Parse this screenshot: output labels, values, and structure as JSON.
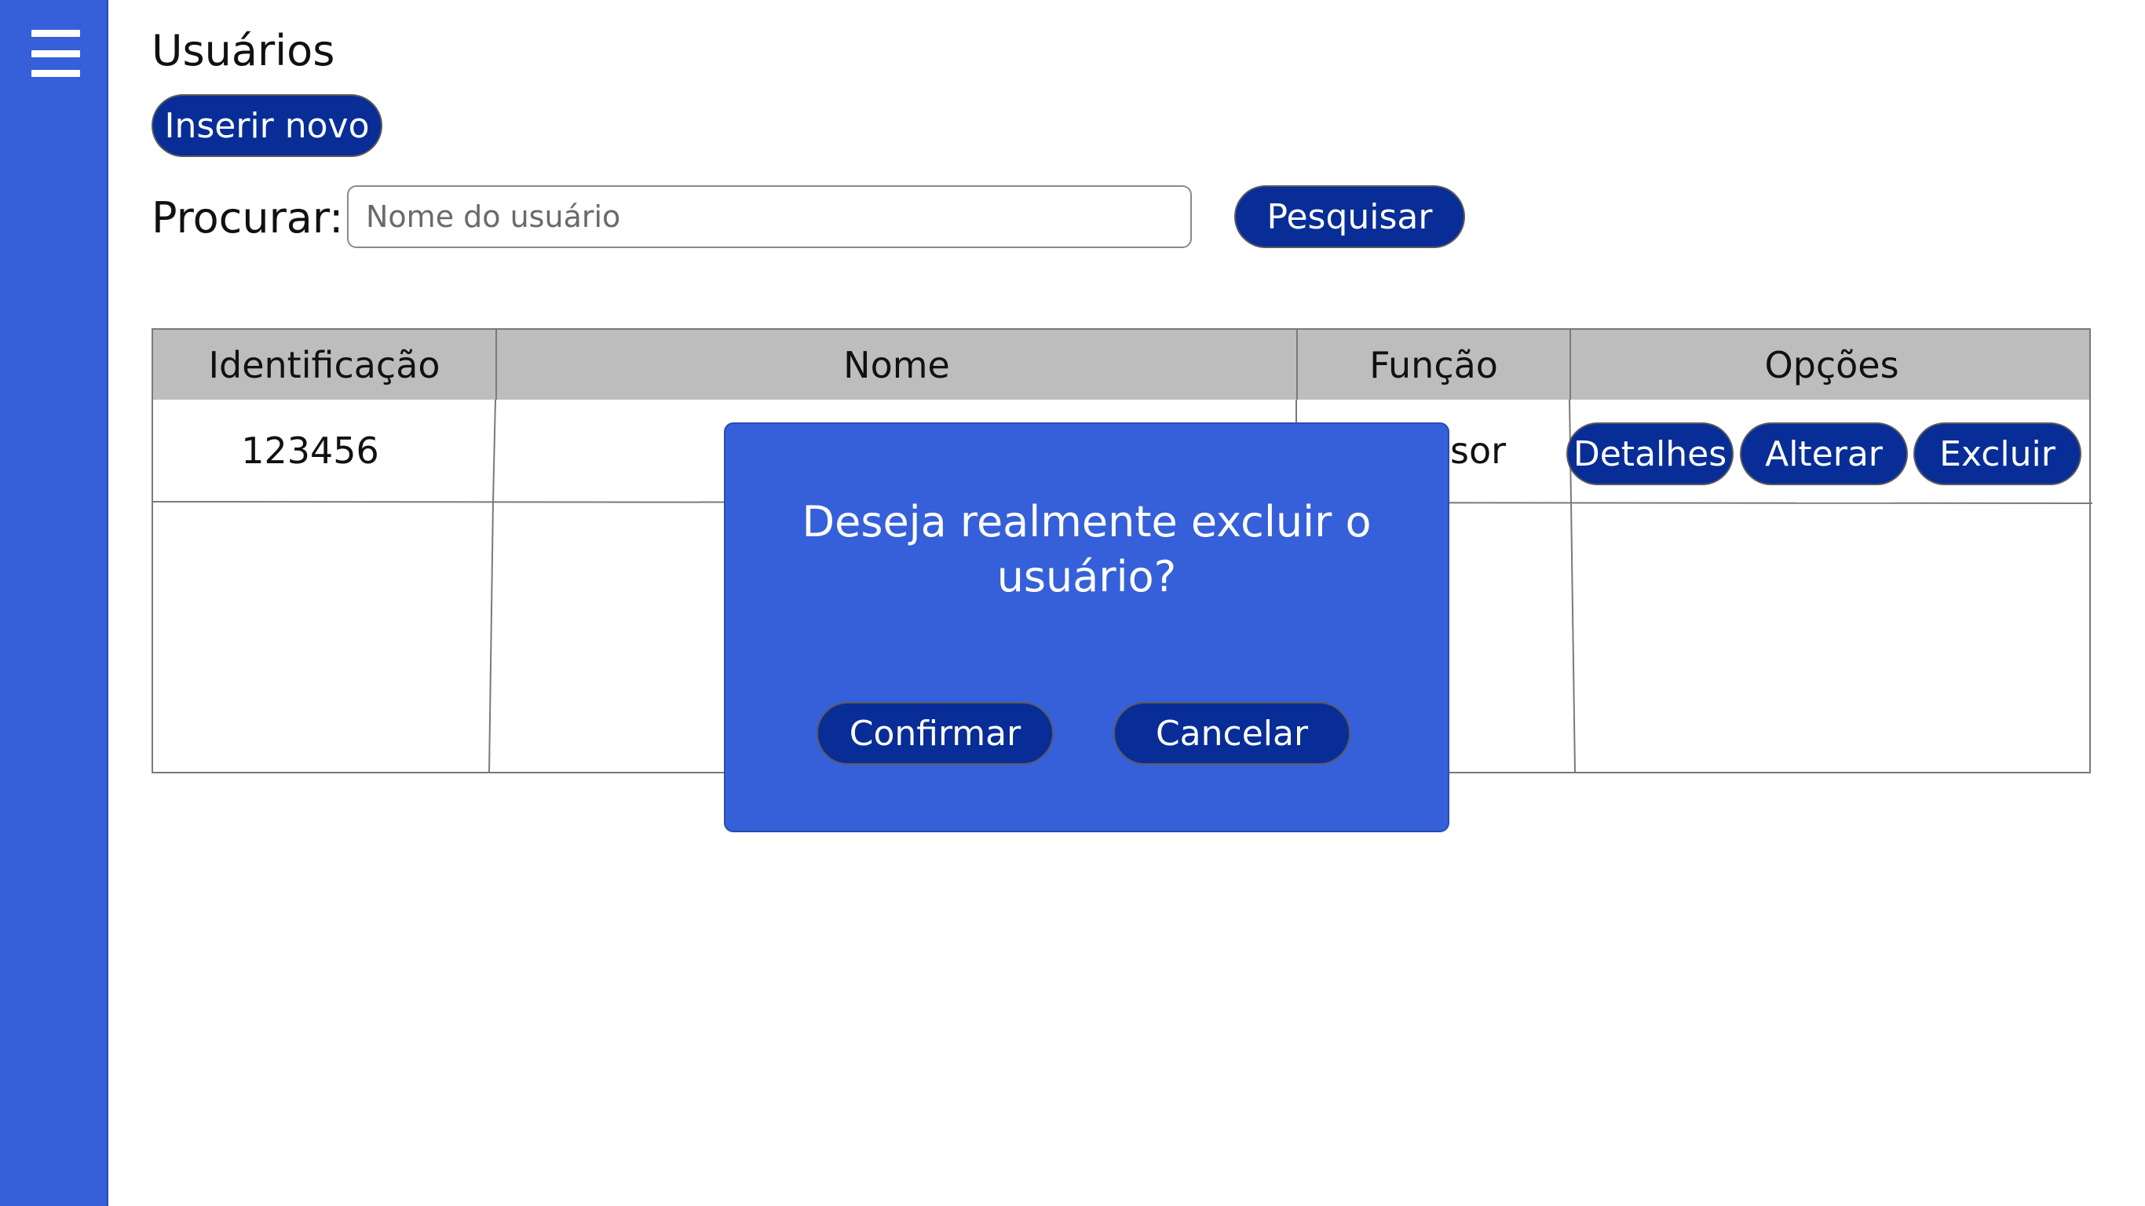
{
  "sidebar": {
    "menu_icon": "hamburger-menu-icon"
  },
  "page": {
    "title": "Usuários",
    "insert_button_label": "Inserir novo"
  },
  "search": {
    "label": "Procurar:",
    "placeholder": "Nome do usuário",
    "value": "",
    "button_label": "Pesquisar"
  },
  "table": {
    "headers": [
      "Identificação",
      "Nome",
      "Função",
      "Opções"
    ],
    "rows": [
      {
        "id": "123456",
        "name": "",
        "role_visible": "sor"
      }
    ],
    "row_buttons": {
      "details": "Detalhes",
      "edit": "Alterar",
      "delete": "Excluir"
    }
  },
  "dialog": {
    "message": "Deseja realmente excluir o usuário?",
    "confirm_label": "Confirmar",
    "cancel_label": "Cancelar"
  },
  "colors": {
    "sidebar": "#3660d9",
    "dialog": "#3660d9",
    "button": "#082d97",
    "table_header": "#bdbdbd"
  }
}
